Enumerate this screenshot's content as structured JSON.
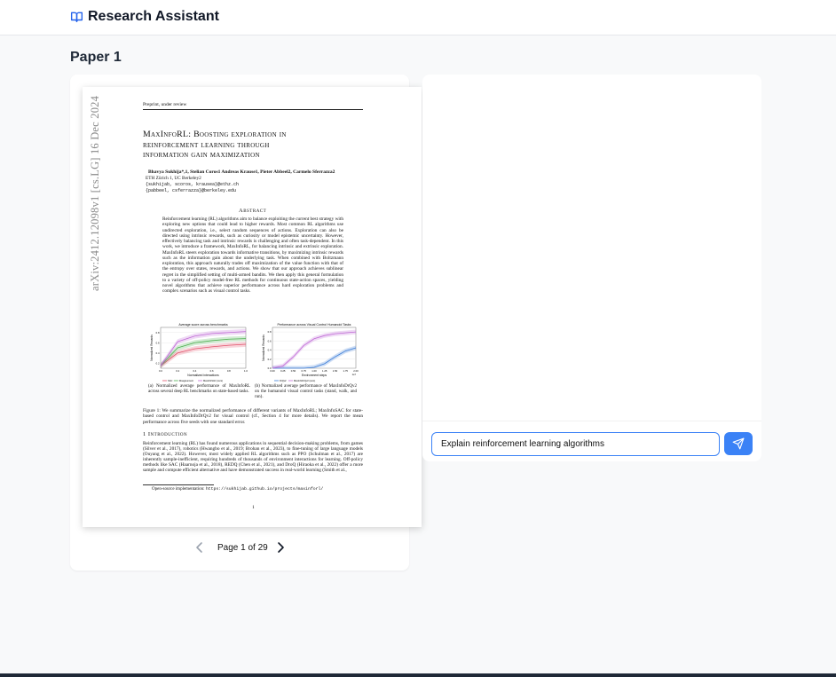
{
  "header": {
    "app_title": "Research Assistant",
    "logo_icon": "book-open-icon"
  },
  "paper_heading": "Paper 1",
  "pdf": {
    "preprint": "Preprint, under review",
    "title_line1": "MaxInfoRL: Boosting exploration in",
    "title_line2": "reinforcement learning through",
    "title_line3": "information gain maximization",
    "authors": "Bhavya Sukhija*,1, Stelian Coros1 Andreas Krause1, Pieter Abbeel2, Carmelo Sferrazza2",
    "affiliation": "ETH Zürich 1, UC Berkeley2",
    "emails": "{sukhijab, scoros, krausea}@ethz.ch\n{pabbeel, csferrazza}@berkeley.edu",
    "arxiv_stamp": "arXiv:2412.12098v1  [cs.LG]  16 Dec 2024",
    "abstract_heading": "Abstract",
    "abstract_text": "Reinforcement learning (RL) algorithms aim to balance exploiting the current best strategy with exploring new options that could lead to higher rewards. Most common RL algorithms use undirected exploration, i.e., select random sequences of actions. Exploration can also be directed using intrinsic rewards, such as curiosity or model epistemic uncertainty. However, effectively balancing task and intrinsic rewards is challenging and often task-dependent. In this work, we introduce a framework, MaxInfoRL, for balancing intrinsic and extrinsic exploration. MaxInfoRL steers exploration towards informative transitions, by maximizing intrinsic rewards such as the information gain about the underlying task. When combined with Boltzmann exploration, this approach naturally trades off maximization of the value function with that of the entropy over states, rewards, and actions. We show that our approach achieves sublinear regret in the simplified setting of multi-armed bandits. We then apply this general formulation to a variety of off-policy model-free RL methods for continuous state-action spaces, yielding novel algorithms that achieve superior performance across hard exploration problems and complex scenarios such as visual control tasks.",
    "caption_a": "(a) Normalized average performance of MaxInfoRL across several deep RL benchmarks on state-based tasks.",
    "caption_b": "(b) Normalized average performance of MaxInfoDrQv2 on the humanoid visual control tasks (stand, walk, and run).",
    "figure_caption": "Figure 1: We summarize the normalized performance of different variants of MaxInfoRL; MaxInfoSAC for state-based control and MaxInfoDrQv2 for visual control (cf., Section 4 for more details). We report the mean performance across five seeds with one standard error.",
    "intro_heading": "1   Introduction",
    "intro_text": "Reinforcement learning (RL) has found numerous applications in sequential decision-making problems, from games (Silver et al., 2017), robotics (Hwangbo et al., 2019; Brohan et al., 2023), to fine-tuning of large language models (Ouyang et al., 2022). However, most widely applied RL algorithms such as PPO (Schulman et al., 2017) are inherently sample-inefficient, requiring hundreds of thousands of environment interactions for learning. Off-policy methods like SAC (Haarnoja et al., 2018), REDQ (Chen et al., 2021), and DroQ (Hiraoka et al., 2022) offer a more sample and compute efficient alternative and have demonstrated success in real-world learning (Smith et al.,",
    "footnote_label": "Open-source implementation: ",
    "footnote_url": "https://sukhijab.github.io/projects/maxinforl/",
    "page_number": "1"
  },
  "chart_data": [
    {
      "type": "line",
      "title": "Average score across benchmarks",
      "xlabel": "Normalized interactions",
      "ylabel": "Normalized Rewards",
      "x": [
        0.0,
        0.2,
        0.4,
        0.6,
        0.8,
        1.0
      ],
      "x_ticks": [
        "0.0",
        "0.2",
        "0.4",
        "0.6",
        "0.8",
        "1.0"
      ],
      "y_ticks": [
        "0.2",
        "0.4",
        "0.6",
        "0.8"
      ],
      "ylim": [
        0.1,
        0.9
      ],
      "series": [
        {
          "name": "SAC",
          "color": "#e2536c",
          "values": [
            0.15,
            0.4,
            0.48,
            0.52,
            0.55,
            0.57
          ]
        },
        {
          "name": "Disagreement",
          "color": "#4caf50",
          "values": [
            0.15,
            0.5,
            0.6,
            0.64,
            0.67,
            0.68
          ]
        },
        {
          "name": "MaxInfoSAC (ours)",
          "color": "#c06bd6",
          "values": [
            0.15,
            0.62,
            0.73,
            0.78,
            0.8,
            0.82
          ]
        }
      ]
    },
    {
      "type": "line",
      "title": "Performance across Visual Control Humanoid Tasks",
      "xlabel": "Environment steps",
      "ylabel": "Normalized Rewards",
      "x": [
        0.0,
        0.25,
        0.5,
        0.75,
        1.0,
        1.25,
        1.5,
        1.75,
        2.0
      ],
      "x_ticks": [
        "0.00",
        "0.25",
        "0.50",
        "0.75",
        "1.00",
        "1.25",
        "1.50",
        "1.75",
        "2.00"
      ],
      "x_unit": "1e7",
      "y_ticks": [
        "0.0",
        "0.2",
        "0.4",
        "0.6",
        "0.8"
      ],
      "ylim": [
        0.0,
        0.9
      ],
      "series": [
        {
          "name": "DrQv2",
          "color": "#3b7dd8",
          "values": [
            0.0,
            0.0,
            0.0,
            0.0,
            0.02,
            0.1,
            0.25,
            0.38,
            0.45
          ]
        },
        {
          "name": "MaxInfoDrQv2 (ours)",
          "color": "#c06bd6",
          "values": [
            0.0,
            0.05,
            0.25,
            0.5,
            0.65,
            0.72,
            0.76,
            0.78,
            0.8
          ]
        }
      ]
    }
  ],
  "pager": {
    "label": "Page 1 of 29",
    "prev_icon": "chevron-left-icon",
    "next_icon": "chevron-right-icon"
  },
  "chat": {
    "input_value": "Explain reinforcement learning algorithms",
    "send_icon": "send-icon"
  },
  "colors": {
    "accent": "#3b82f6",
    "logo": "#2563eb"
  }
}
